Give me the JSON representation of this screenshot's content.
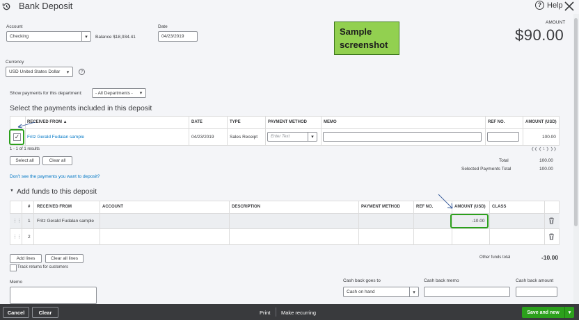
{
  "header": {
    "title": "Bank Deposit",
    "help_label": "Help",
    "help_glyph": "?",
    "close_glyph": "✕"
  },
  "account": {
    "label": "Account",
    "value": "Checking",
    "balance_label": "Balance",
    "balance_value": "$18,934.41"
  },
  "date": {
    "label": "Date",
    "value": "04/23/2019"
  },
  "amount": {
    "label": "AMOUNT",
    "value": "$90.00"
  },
  "annotation": {
    "line1": "Sample",
    "line2": "screenshot"
  },
  "currency": {
    "label": "Currency",
    "value": "USD United States Dollar",
    "info_glyph": "?"
  },
  "department": {
    "label": "Show payments for this department:",
    "value": "- All Departments -"
  },
  "payments": {
    "title": "Select the payments included in this deposit",
    "columns": {
      "received_from": "RECEIVED FROM ▲",
      "date": "DATE",
      "type": "TYPE",
      "payment_method": "PAYMENT METHOD",
      "memo": "MEMO",
      "ref_no": "REF NO.",
      "amount": "AMOUNT (USD)"
    },
    "rows": [
      {
        "checked": true,
        "check_glyph": "✓",
        "received_from": "Fritz Gerald Fudalan sample",
        "date": "04/23/2019",
        "type": "Sales Receipt",
        "payment_method_placeholder": "Enter Text",
        "memo": "",
        "ref_no": "",
        "amount": "100.00"
      }
    ],
    "count_text": "1 - 1 of 1 results",
    "pager": "❮❮ ❮ 1 ❯ ❯❯",
    "select_all": "Select all",
    "clear_all": "Clear all",
    "total_label": "Total",
    "total_value": "100.00",
    "selected_total_label": "Selected Payments Total",
    "selected_total_value": "100.00",
    "missing_link": "Don't see the payments you want to deposit?"
  },
  "funds": {
    "title": "Add funds to this deposit",
    "collapse_glyph": "▼",
    "columns": {
      "num": "#",
      "received_from": "RECEIVED FROM",
      "account": "ACCOUNT",
      "description": "DESCRIPTION",
      "payment_method": "PAYMENT METHOD",
      "ref_no": "REF NO.",
      "amount": "AMOUNT (USD)",
      "class": "CLASS"
    },
    "rows": [
      {
        "num": "1",
        "received_from": "Fritz Gerald Fudalan sample",
        "account": "",
        "description": "",
        "payment_method": "",
        "ref_no": "",
        "amount": "-10.00",
        "class": ""
      },
      {
        "num": "2",
        "received_from": "",
        "account": "",
        "description": "",
        "payment_method": "",
        "ref_no": "",
        "amount": "",
        "class": ""
      }
    ],
    "add_lines": "Add lines",
    "clear_all_lines": "Clear all lines",
    "other_total_label": "Other funds total",
    "other_total_value": "-10.00",
    "track_returns": "Track returns for customers"
  },
  "memo": {
    "label": "Memo"
  },
  "cashback": {
    "goes_to_label": "Cash back goes to",
    "goes_to_value": "Cash on hand",
    "memo_label": "Cash back memo",
    "amount_label": "Cash back amount"
  },
  "footer": {
    "cancel": "Cancel",
    "clear": "Clear",
    "print": "Print",
    "make_recurring": "Make recurring",
    "save_new": "Save and new"
  },
  "colors": {
    "brand_green": "#2ca01c",
    "link_blue": "#0077c5",
    "footer_bg": "#393a3d",
    "annotation_green": "#92d050"
  }
}
